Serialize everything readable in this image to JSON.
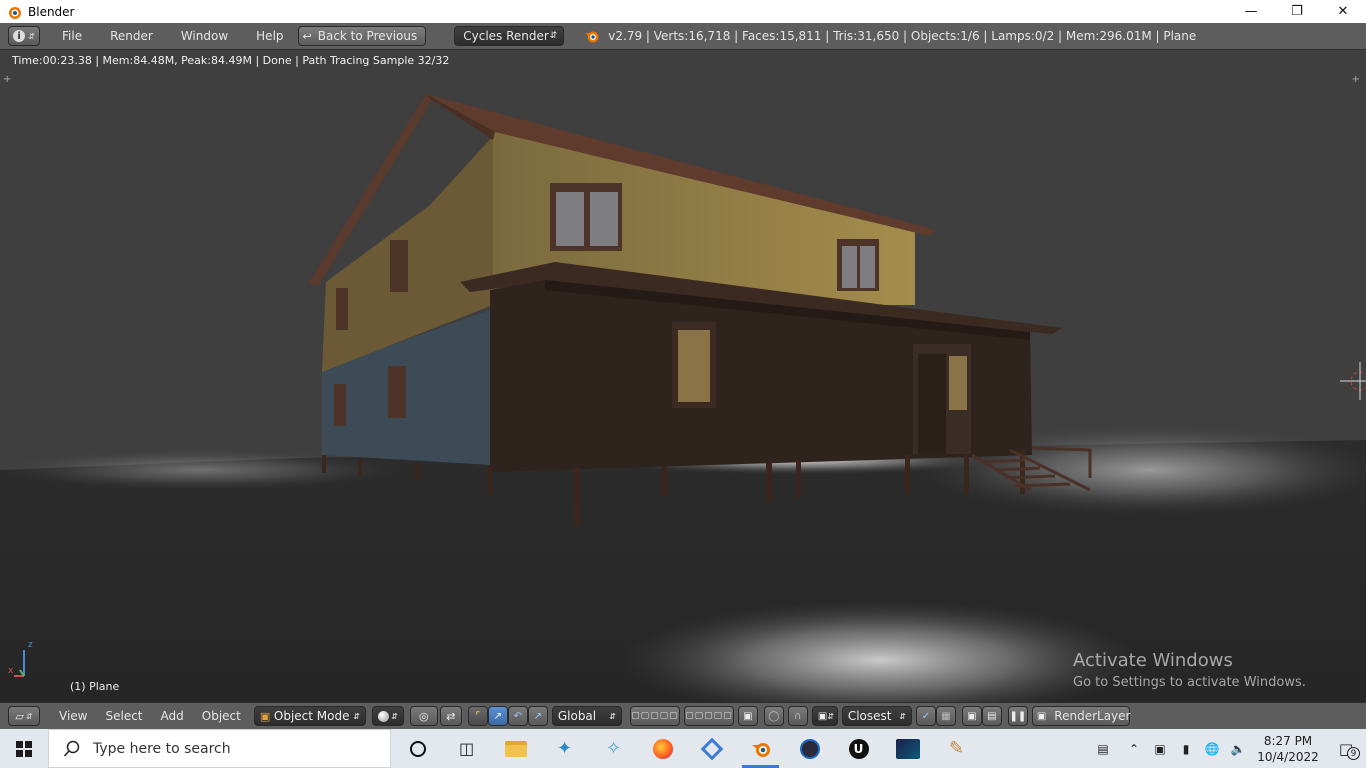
{
  "window": {
    "title": "Blender",
    "minimize_icon": "minimize-icon",
    "maximize_icon": "restore-icon",
    "close_icon": "close-icon"
  },
  "menubar": {
    "menus": [
      "File",
      "Render",
      "Window",
      "Help"
    ],
    "back_button": "Back to Previous",
    "render_engine": "Cycles Render",
    "stats": "v2.79 | Verts:16,718 | Faces:15,811 | Tris:31,650 | Objects:1/6 | Lamps:0/2 | Mem:296.01M | Plane"
  },
  "viewport": {
    "render_status": "Time:00:23.38 | Mem:84.48M, Peak:84.49M | Done | Path Tracing Sample 32/32",
    "object_label": "(1) Plane",
    "axis_labels": {
      "x": "x",
      "z": "z"
    },
    "watermark": {
      "line1": "Activate Windows",
      "line2": "Go to Settings to activate Windows."
    }
  },
  "bottombar": {
    "menus": [
      "View",
      "Select",
      "Add",
      "Object"
    ],
    "mode": "Object Mode",
    "orientation": "Global",
    "snap_target": "Closest",
    "render_layer": "RenderLayer"
  },
  "taskbar": {
    "search_placeholder": "Type here to search",
    "apps": [
      "cortana-icon",
      "task-view-icon",
      "file-explorer-icon",
      "dolphin-icon",
      "puzzle-icon",
      "firefox-icon",
      "app-icon",
      "blender-icon",
      "obs-icon",
      "unreal-icon",
      "adobe-icon",
      "paint-icon"
    ],
    "active_app": "blender-icon",
    "time": "8:27 PM",
    "date": "10/4/2022",
    "notification_count": "9"
  },
  "colors": {
    "blender_header": "#5d5d5d",
    "viewport_bg": "#3f3f3f",
    "taskbar_bg": "#e3e7ee",
    "accent": "#3b78d8"
  }
}
